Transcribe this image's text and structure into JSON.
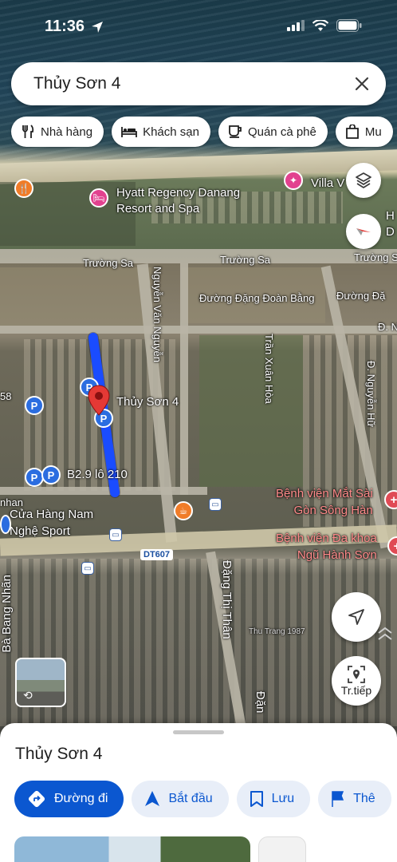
{
  "status_bar": {
    "time": "11:36"
  },
  "search": {
    "query": "Thủy Sơn 4"
  },
  "chips": [
    {
      "label": "Nhà hàng",
      "icon": "restaurant-icon"
    },
    {
      "label": "Khách sạn",
      "icon": "hotel-icon"
    },
    {
      "label": "Quán cà phê",
      "icon": "coffee-icon"
    },
    {
      "label": "Mu",
      "icon": "shopping-bag-icon"
    }
  ],
  "map": {
    "labels": {
      "hyatt": "Hyatt Regency Danang\nResort and Spa",
      "villa": "Villa V",
      "truong_sa_1": "Trường Sa",
      "truong_sa_2": "Trường Sa",
      "truong_sa_3": "Trường Sa",
      "nguyen_van_nguyen": "Nguyễn Văn Nguyễn",
      "dang_doan_bang_1": "Đường Đặng Đoàn Bằng",
      "dang_doan_bang_2": "Đường Đặ",
      "tran_xuan_hoa": "Trần Xuân Hòa",
      "d_nguyen_huu": "Đ. Nguyễn Hữ",
      "d_n": "Đ. N",
      "h_d_1": "H",
      "h_d_2": "D",
      "thuy_son_4": "Thủy Sơn 4",
      "b29": "B2.9 lô 210",
      "num_58": "58",
      "cua_hang": "Cửa Hàng Nam\nNghệ Sport",
      "nhan": "nhan",
      "bv_mat": "Bệnh viện Mắt Sài\nGòn Sông Hàn",
      "bv_da_khoa": "Bệnh viện Đa khoa\nNgũ Hành Sơn",
      "dt607": "DT607",
      "dang_thi_than": "Đặng Thị Thân",
      "dang_right": "Đặn",
      "bang_nhan": "Bà Bang Nhãn",
      "thu_trang": "Thu Trang 1987"
    }
  },
  "buttons": {
    "directions_fab": "Tr.tiếp"
  },
  "sheet": {
    "title": "Thủy Sơn 4",
    "actions": [
      {
        "label": "Đường đi",
        "icon": "directions-icon"
      },
      {
        "label": "Bắt đầu",
        "icon": "navigation-arrow-icon"
      },
      {
        "label": "Lưu",
        "icon": "bookmark-icon"
      },
      {
        "label": "Thê",
        "icon": "flag-icon"
      }
    ]
  },
  "colors": {
    "accent": "#0b57d0",
    "route": "#1a4cff",
    "marker": "#e53935"
  }
}
